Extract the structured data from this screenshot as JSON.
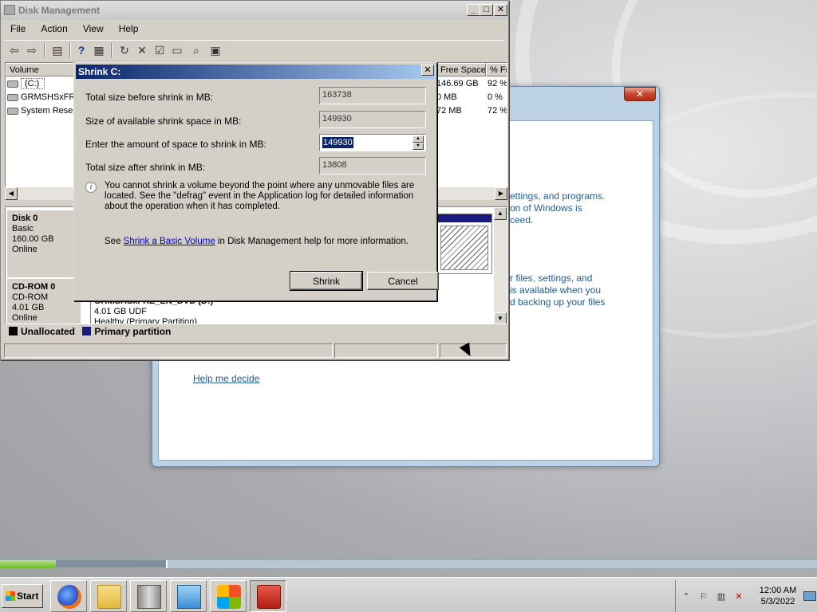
{
  "disk_management": {
    "title": "Disk Management",
    "menu": [
      "File",
      "Action",
      "View",
      "Help"
    ],
    "columns": [
      "Volume",
      "Free Space",
      "% Fr"
    ],
    "volumes": [
      {
        "name": "(C:)",
        "free": "146.69 GB",
        "pct": "92 %"
      },
      {
        "name": "GRMSHSxFRE",
        "free": "0 MB",
        "pct": "0 %"
      },
      {
        "name": "System Reser",
        "free": "72 MB",
        "pct": "72 %"
      }
    ],
    "disks": [
      {
        "name": "Disk 0",
        "type": "Basic",
        "size": "160.00 GB",
        "status": "Online"
      },
      {
        "name": "CD-ROM 0",
        "type": "CD-ROM",
        "size": "4.01 GB",
        "status": "Online"
      }
    ],
    "cd_partition": {
      "label": "GRMSHSxFRE_EN_DVD (D:)",
      "fs": "4.01 GB UDF",
      "health": "Healthy (Primary Partition)"
    },
    "legend": [
      {
        "label": "Unallocated",
        "color": "#000000"
      },
      {
        "label": "Primary partition",
        "color": "#1a1a7a"
      }
    ]
  },
  "dialog": {
    "title": "Shrink C:",
    "total_before_label": "Total size before shrink in MB:",
    "total_before_value": "163738",
    "available_label": "Size of available shrink space in MB:",
    "available_value": "149930",
    "amount_label": "Enter the amount of space to shrink in MB:",
    "amount_value": "149930",
    "total_after_label": "Total size after shrink in MB:",
    "total_after_value": "13808",
    "info_text": "You cannot shrink a volume beyond the point where any unmovable files are located. See the \"defrag\" event in the Application log for detailed information about the operation when it has completed.",
    "help_prefix": "See ",
    "help_link": "Shrink a Basic Volume",
    "help_suffix": " in Disk Management help for more information.",
    "shrink_label": "Shrink",
    "cancel_label": "Cancel"
  },
  "background_window": {
    "lines": [
      "ettings, and programs.",
      "on of Windows is",
      "ceed.",
      "r files, settings, and",
      "is available when you",
      "d backing up your files"
    ],
    "help_link": "Help me decide"
  },
  "taskbar": {
    "start_label": "Start",
    "time": "12:00 AM",
    "date": "5/3/2022"
  }
}
